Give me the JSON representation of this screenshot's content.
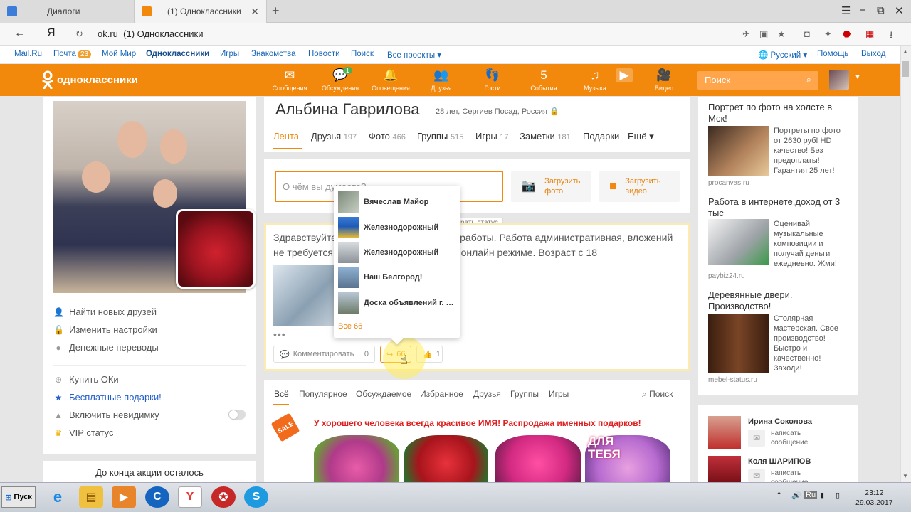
{
  "browser": {
    "tab1": "Диалоги",
    "tab2": "(1) Одноклассники",
    "new_tab": "+",
    "url_domain": "ok.ru",
    "url_title": "(1) Одноклассники",
    "back": "←",
    "yandex": "Я",
    "reload": "↻",
    "menu": "☰",
    "minimize": "−",
    "maximize": "⧉",
    "close": "✕",
    "download": "⭳"
  },
  "portal": {
    "mailru": "Mail.Ru",
    "mail": "Почта",
    "mail_count": "23",
    "myworld": "Мой Мир",
    "ok": "Одноклассники",
    "games": "Игры",
    "dating": "Знакомства",
    "news": "Новости",
    "search": "Поиск",
    "all_projects": "Все проекты ▾",
    "lang": "Русский ▾",
    "help": "Помощь",
    "logout": "Выход"
  },
  "header": {
    "logo": "одноклассники",
    "search_placeholder": "Поиск",
    "nav": [
      {
        "icon": "✉",
        "label": "Сообщения"
      },
      {
        "icon": "💬",
        "label": "Обсуждения",
        "badge": "1"
      },
      {
        "icon": "🔔",
        "label": "Оповещения"
      },
      {
        "icon": "👥",
        "label": "Друзья"
      },
      {
        "icon": "👣",
        "label": "Гости"
      },
      {
        "icon": "5",
        "label": "События"
      },
      {
        "icon": "♫",
        "label": "Музыка"
      },
      {
        "icon": "▶",
        "label": ""
      },
      {
        "icon": "🎥",
        "label": "Видео"
      }
    ]
  },
  "left": {
    "menu": [
      "Найти новых друзей",
      "Изменить настройки",
      "Денежные переводы",
      "Купить ОКи",
      "Бесплатные подарки!",
      "Включить невидимку",
      "VIP статус"
    ],
    "promo": "До конца акции осталось"
  },
  "profile": {
    "name": "Альбина Гаврилова",
    "meta": "28 лет, Сергиев Посад, Россия",
    "tabs": [
      {
        "label": "Лента",
        "n": ""
      },
      {
        "label": "Друзья",
        "n": "197"
      },
      {
        "label": "Фото",
        "n": "466"
      },
      {
        "label": "Группы",
        "n": "515"
      },
      {
        "label": "Игры",
        "n": "17"
      },
      {
        "label": "Заметки",
        "n": "181"
      },
      {
        "label": "Подарки",
        "n": ""
      },
      {
        "label": "Ещё ▾",
        "n": ""
      }
    ]
  },
  "status": {
    "placeholder": "О чём вы думаете?",
    "upload_photo": "Загрузить фото",
    "upload_video": "Загрузить видео",
    "tip": "рать статус"
  },
  "post": {
    "text": "Здравствуйте! Приглашаем для онлайн работы. Работа административная, вложений не требуется, все законное. Работаем в онлайн режиме. Возраст с 18",
    "dots": "•••",
    "comment": "Комментировать",
    "comment_n": "0",
    "share_n": "66",
    "like_n": "1"
  },
  "popup": {
    "items": [
      "Вячеслав Майор",
      "Железнодорожный",
      "Железнодорожный",
      "Наш Белгород!",
      "Доска объявлений г. …"
    ],
    "all": "Все 66"
  },
  "feed": {
    "tabs": [
      "Всё",
      "Популярное",
      "Обсуждаемое",
      "Избранное",
      "Друзья",
      "Группы",
      "Игры"
    ],
    "search": "Поиск",
    "sale": "SALE",
    "headline": "У хорошего человека всегда красивое ИМЯ! Распродажа именных подарков!",
    "for_you": "ДЛЯ ТЕБЯ"
  },
  "ads": [
    {
      "title": "Портрет по фото на холсте в Мск!",
      "text": "Портреты по фото от 2630 руб! HD качество! Без предоплаты! Гарантия 25 лет!",
      "src": "procanvas.ru"
    },
    {
      "title": "Работа в интернете,доход от 3 тыс",
      "text": "Оценивай музыкальные композиции и получай деньги ежедневно. Жми!",
      "src": "paybiz24.ru"
    },
    {
      "title": "Деревянные двери. Производство!",
      "text": "Столярная мастерская. Свое производство! Быстро и качественно! Заходи!",
      "src": "mebel-status.ru"
    }
  ],
  "friends": [
    {
      "name": "Ирина Соколова",
      "msg": "написать сообщение"
    },
    {
      "name": "Коля ШАРИПОВ",
      "msg": "написать сообщение"
    }
  ],
  "taskbar": {
    "start": "Пуск",
    "lang": "Ru",
    "time": "23:12",
    "date": "29.03.2017"
  }
}
